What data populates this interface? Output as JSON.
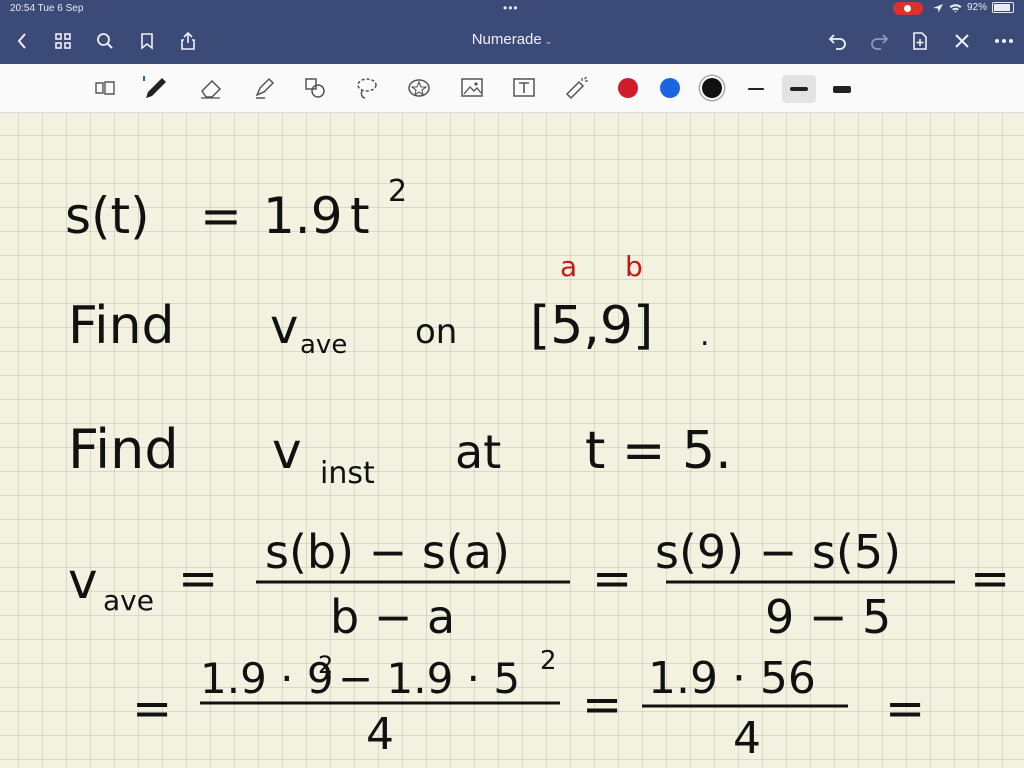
{
  "status": {
    "time": "20:54  Tue 6 Sep",
    "battery": "92%",
    "dots": "•••"
  },
  "app": {
    "title": "Numerade"
  },
  "toolbar": {
    "ink_colors": [
      "#d11a2a",
      "#1a66e0",
      "#111111"
    ],
    "selected_stroke": "medium"
  },
  "notes": {
    "line1": {
      "lhs": "s(t)",
      "eq": "=",
      "coef": "1.9",
      "var": "t",
      "exp": "2"
    },
    "annot_a": "a",
    "annot_b": "b",
    "line2": {
      "find": "Find",
      "v": "v",
      "sub": "ave",
      "on": "on",
      "interval": "[5,9]",
      "dot": "."
    },
    "line3": {
      "find": "Find",
      "v": "v",
      "sub": "inst",
      "at": "at",
      "cond": "t = 5."
    },
    "formula": {
      "v": "v",
      "sub": "ave",
      "eq": "=",
      "num1": "s(b) − s(a)",
      "den1": "b − a",
      "num2": "s(9) − s(5)",
      "den2": "9 − 5",
      "eq_end": "="
    },
    "calc": {
      "eq": "=",
      "num1_a": "1.9 · 9",
      "num1_a_exp": "2",
      "num1_b": "− 1.9 · 5",
      "num1_b_exp": "2",
      "den1": "4",
      "num2": "1.9 · 56",
      "den2": "4",
      "eq_end": "="
    }
  }
}
